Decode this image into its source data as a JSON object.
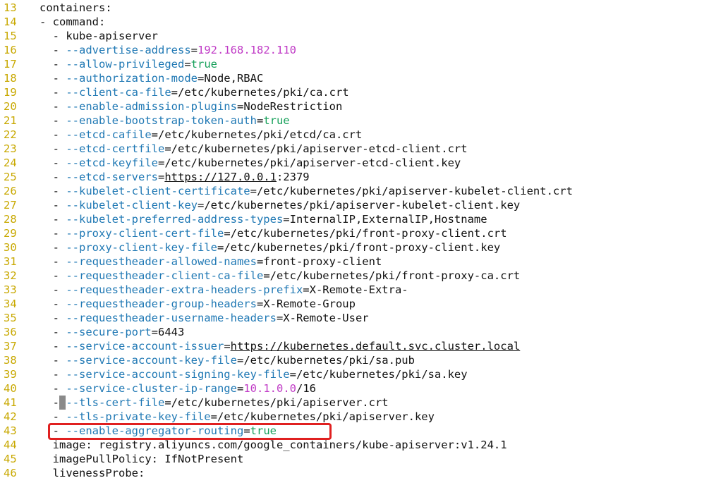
{
  "colors": {
    "line_number": "#c8a800",
    "flag": "#1f78b4",
    "string": "#c03bc6",
    "boolean": "#16a05a",
    "highlight": "#e02020"
  },
  "lines": [
    {
      "n": "13",
      "indent": 0,
      "segments": [
        {
          "t": "containers:"
        }
      ]
    },
    {
      "n": "14",
      "indent": 0,
      "segments": [
        {
          "t": "- command:"
        }
      ]
    },
    {
      "n": "15",
      "indent": 2,
      "segments": [
        {
          "t": "- kube-apiserver"
        }
      ]
    },
    {
      "n": "16",
      "indent": 2,
      "segments": [
        {
          "t": "- "
        },
        {
          "t": "--advertise-address",
          "c": "flag"
        },
        {
          "t": "="
        },
        {
          "t": "192.168.182.110",
          "c": "str"
        }
      ]
    },
    {
      "n": "17",
      "indent": 2,
      "segments": [
        {
          "t": "- "
        },
        {
          "t": "--allow-privileged",
          "c": "flag"
        },
        {
          "t": "="
        },
        {
          "t": "true",
          "c": "bool"
        }
      ]
    },
    {
      "n": "18",
      "indent": 2,
      "segments": [
        {
          "t": "- "
        },
        {
          "t": "--authorization-mode",
          "c": "flag"
        },
        {
          "t": "=Node,RBAC"
        }
      ]
    },
    {
      "n": "19",
      "indent": 2,
      "segments": [
        {
          "t": "- "
        },
        {
          "t": "--client-ca-file",
          "c": "flag"
        },
        {
          "t": "=/etc/kubernetes/pki/ca.crt"
        }
      ]
    },
    {
      "n": "20",
      "indent": 2,
      "segments": [
        {
          "t": "- "
        },
        {
          "t": "--enable-admission-plugins",
          "c": "flag"
        },
        {
          "t": "=NodeRestriction"
        }
      ]
    },
    {
      "n": "21",
      "indent": 2,
      "segments": [
        {
          "t": "- "
        },
        {
          "t": "--enable-bootstrap-token-auth",
          "c": "flag"
        },
        {
          "t": "="
        },
        {
          "t": "true",
          "c": "bool"
        }
      ]
    },
    {
      "n": "22",
      "indent": 2,
      "segments": [
        {
          "t": "- "
        },
        {
          "t": "--etcd-cafile",
          "c": "flag"
        },
        {
          "t": "=/etc/kubernetes/pki/etcd/ca.crt"
        }
      ]
    },
    {
      "n": "23",
      "indent": 2,
      "segments": [
        {
          "t": "- "
        },
        {
          "t": "--etcd-certfile",
          "c": "flag"
        },
        {
          "t": "=/etc/kubernetes/pki/apiserver-etcd-client.crt"
        }
      ]
    },
    {
      "n": "24",
      "indent": 2,
      "segments": [
        {
          "t": "- "
        },
        {
          "t": "--etcd-keyfile",
          "c": "flag"
        },
        {
          "t": "=/etc/kubernetes/pki/apiserver-etcd-client.key"
        }
      ]
    },
    {
      "n": "25",
      "indent": 2,
      "segments": [
        {
          "t": "- "
        },
        {
          "t": "--etcd-servers",
          "c": "flag"
        },
        {
          "t": "="
        },
        {
          "t": "https://127.0.0.1",
          "c": "url"
        },
        {
          "t": ":2379"
        }
      ]
    },
    {
      "n": "26",
      "indent": 2,
      "segments": [
        {
          "t": "- "
        },
        {
          "t": "--kubelet-client-certificate",
          "c": "flag"
        },
        {
          "t": "=/etc/kubernetes/pki/apiserver-kubelet-client.crt"
        }
      ]
    },
    {
      "n": "27",
      "indent": 2,
      "segments": [
        {
          "t": "- "
        },
        {
          "t": "--kubelet-client-key",
          "c": "flag"
        },
        {
          "t": "=/etc/kubernetes/pki/apiserver-kubelet-client.key"
        }
      ]
    },
    {
      "n": "28",
      "indent": 2,
      "segments": [
        {
          "t": "- "
        },
        {
          "t": "--kubelet-preferred-address-types",
          "c": "flag"
        },
        {
          "t": "=InternalIP,ExternalIP,Hostname"
        }
      ]
    },
    {
      "n": "29",
      "indent": 2,
      "segments": [
        {
          "t": "- "
        },
        {
          "t": "--proxy-client-cert-file",
          "c": "flag"
        },
        {
          "t": "=/etc/kubernetes/pki/front-proxy-client.crt"
        }
      ]
    },
    {
      "n": "30",
      "indent": 2,
      "segments": [
        {
          "t": "- "
        },
        {
          "t": "--proxy-client-key-file",
          "c": "flag"
        },
        {
          "t": "=/etc/kubernetes/pki/front-proxy-client.key"
        }
      ]
    },
    {
      "n": "31",
      "indent": 2,
      "segments": [
        {
          "t": "- "
        },
        {
          "t": "--requestheader-allowed-names",
          "c": "flag"
        },
        {
          "t": "=front-proxy-client"
        }
      ]
    },
    {
      "n": "32",
      "indent": 2,
      "segments": [
        {
          "t": "- "
        },
        {
          "t": "--requestheader-client-ca-file",
          "c": "flag"
        },
        {
          "t": "=/etc/kubernetes/pki/front-proxy-ca.crt"
        }
      ]
    },
    {
      "n": "33",
      "indent": 2,
      "segments": [
        {
          "t": "- "
        },
        {
          "t": "--requestheader-extra-headers-prefix",
          "c": "flag"
        },
        {
          "t": "=X-Remote-Extra-"
        }
      ]
    },
    {
      "n": "34",
      "indent": 2,
      "segments": [
        {
          "t": "- "
        },
        {
          "t": "--requestheader-group-headers",
          "c": "flag"
        },
        {
          "t": "=X-Remote-Group"
        }
      ]
    },
    {
      "n": "35",
      "indent": 2,
      "segments": [
        {
          "t": "- "
        },
        {
          "t": "--requestheader-username-headers",
          "c": "flag"
        },
        {
          "t": "=X-Remote-User"
        }
      ]
    },
    {
      "n": "36",
      "indent": 2,
      "segments": [
        {
          "t": "- "
        },
        {
          "t": "--secure-port",
          "c": "flag"
        },
        {
          "t": "=6443"
        }
      ]
    },
    {
      "n": "37",
      "indent": 2,
      "segments": [
        {
          "t": "- "
        },
        {
          "t": "--service-account-issuer",
          "c": "flag"
        },
        {
          "t": "="
        },
        {
          "t": "https://kubernetes.default.svc.cluster.local",
          "c": "url"
        }
      ]
    },
    {
      "n": "38",
      "indent": 2,
      "segments": [
        {
          "t": "- "
        },
        {
          "t": "--service-account-key-file",
          "c": "flag"
        },
        {
          "t": "=/etc/kubernetes/pki/sa.pub"
        }
      ]
    },
    {
      "n": "39",
      "indent": 2,
      "segments": [
        {
          "t": "- "
        },
        {
          "t": "--service-account-signing-key-file",
          "c": "flag"
        },
        {
          "t": "=/etc/kubernetes/pki/sa.key"
        }
      ]
    },
    {
      "n": "40",
      "indent": 2,
      "segments": [
        {
          "t": "- "
        },
        {
          "t": "--service-cluster-ip-range",
          "c": "flag"
        },
        {
          "t": "="
        },
        {
          "t": "10.1.0.0",
          "c": "str"
        },
        {
          "t": "/16"
        }
      ]
    },
    {
      "n": "41",
      "indent": 2,
      "segments": [
        {
          "t": "-"
        },
        {
          "t": " ",
          "c": "cursor"
        },
        {
          "t": "--tls-cert-file",
          "c": "flag"
        },
        {
          "t": "=/etc/kubernetes/pki/apiserver.crt"
        }
      ]
    },
    {
      "n": "42",
      "indent": 2,
      "segments": [
        {
          "t": "- "
        },
        {
          "t": "--tls-private-key-file",
          "c": "flag"
        },
        {
          "t": "=/etc/kubernetes/pki/apiserver.key"
        }
      ]
    },
    {
      "n": "43",
      "indent": 2,
      "segments": [
        {
          "t": "- "
        },
        {
          "t": "--enable-aggregator-routing",
          "c": "flag"
        },
        {
          "t": "="
        },
        {
          "t": "true",
          "c": "bool"
        }
      ]
    },
    {
      "n": "44",
      "indent": 2,
      "segments": [
        {
          "t": "image: registry.aliyuncs.com/google_containers/kube-apiserver:v1.24.1"
        }
      ]
    },
    {
      "n": "45",
      "indent": 2,
      "segments": [
        {
          "t": "imagePullPolicy: IfNotPresent"
        }
      ]
    },
    {
      "n": "46",
      "indent": 2,
      "segments": [
        {
          "t": "livenessProbe:"
        }
      ]
    }
  ]
}
